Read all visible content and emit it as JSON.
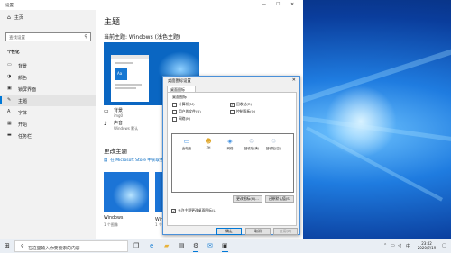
{
  "settings": {
    "window_title": "设置",
    "controls": {
      "minimize": "—",
      "maximize": "☐",
      "close": "✕"
    },
    "sidebar": {
      "home": "主页",
      "search_placeholder": "查找设置",
      "section": "个性化",
      "items": [
        {
          "label": "背景",
          "icon": "image-icon"
        },
        {
          "label": "颜色",
          "icon": "palette-icon"
        },
        {
          "label": "锁屏界面",
          "icon": "lock-screen-icon"
        },
        {
          "label": "主题",
          "icon": "theme-brush-icon"
        },
        {
          "label": "字体",
          "icon": "font-icon"
        },
        {
          "label": "开始",
          "icon": "start-icon"
        },
        {
          "label": "任务栏",
          "icon": "taskbar-icon"
        }
      ],
      "active_item": "主题"
    },
    "main": {
      "title": "主题",
      "current_theme": "当前主题: Windows (浅色主题)",
      "preview_tile_text": "Aa",
      "properties": [
        {
          "title": "背景",
          "sub": "img0",
          "icon": "image-icon"
        },
        {
          "title": "声音",
          "sub": "Windows 默认",
          "icon": "speaker-icon"
        }
      ],
      "change_theme": "更改主题",
      "store_link": "在 Microsoft Store 中获取更多主题",
      "themes": [
        {
          "name": "Windows",
          "sub": "1 个图像"
        },
        {
          "name": "Windows (浅色主题)",
          "sub": "1 个图像"
        }
      ]
    }
  },
  "dialog": {
    "title": "桌面图标设置",
    "close": "✕",
    "tab": "桌面图标",
    "group_label": "桌面图标",
    "checkboxes": [
      {
        "label": "计算机(M)",
        "checked": false
      },
      {
        "label": "回收站(R)",
        "checked": true
      },
      {
        "label": "用户的文件(U)",
        "checked": false
      },
      {
        "label": "控制面板(O)",
        "checked": false
      },
      {
        "label": "网络(N)",
        "checked": false
      }
    ],
    "icons": [
      {
        "label": "此电脑",
        "icon": "this-pc-icon"
      },
      {
        "label": "ZH",
        "icon": "user-folder-icon"
      },
      {
        "label": "网络",
        "icon": "network-icon"
      },
      {
        "label": "回收站(满)",
        "icon": "recycle-bin-full-icon"
      },
      {
        "label": "回收站(空)",
        "icon": "recycle-bin-empty-icon"
      }
    ],
    "change_icon": "更改图标(H)...",
    "restore_default": "还原默认值(S)",
    "allow_themes": "允许主题更改桌面图标(L)",
    "ok": "确定",
    "cancel": "取消",
    "apply": "应用(A)"
  },
  "taskbar": {
    "search_placeholder": "在这里输入你要搜索的内容",
    "icons": [
      "task-view-icon",
      "edge-icon",
      "file-explorer-icon",
      "store-icon",
      "mail-icon",
      "settings-icon",
      "desktop-icon"
    ],
    "time": "23:42",
    "date": "2020/7/19",
    "ime": "中"
  }
}
